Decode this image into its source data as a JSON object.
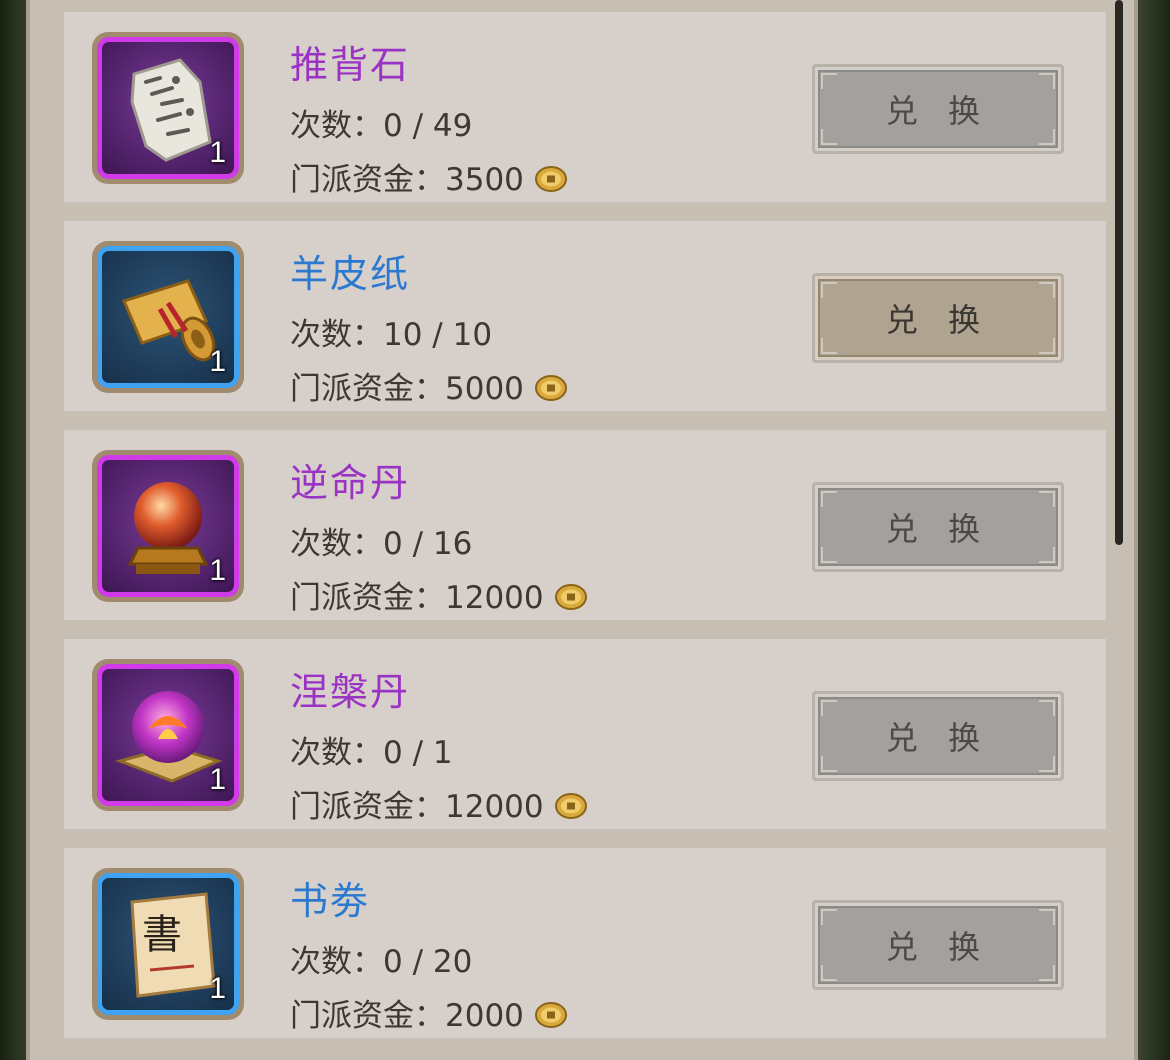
{
  "items": [
    {
      "name": "推背石",
      "rarity": "purple",
      "qty": "1",
      "count_label": "次数：",
      "count_value": "0 / 49",
      "fund_label": "门派资金：",
      "fund_value": "3500",
      "button_label": "兑 换",
      "button_state": "disabled",
      "icon": "stone-tablet-icon"
    },
    {
      "name": "羊皮纸",
      "rarity": "blue",
      "qty": "1",
      "count_label": "次数：",
      "count_value": "10 / 10",
      "fund_label": "门派资金：",
      "fund_value": "5000",
      "button_label": "兑 换",
      "button_state": "active",
      "icon": "scroll-icon"
    },
    {
      "name": "逆命丹",
      "rarity": "purple",
      "qty": "1",
      "count_label": "次数：",
      "count_value": "0 / 16",
      "fund_label": "门派资金：",
      "fund_value": "12000",
      "button_label": "兑 换",
      "button_state": "disabled",
      "icon": "orb-on-stand-icon"
    },
    {
      "name": "涅槃丹",
      "rarity": "purple",
      "qty": "1",
      "count_label": "次数：",
      "count_value": "0 / 1",
      "fund_label": "门派资金：",
      "fund_value": "12000",
      "button_label": "兑 换",
      "button_state": "disabled",
      "icon": "phoenix-orb-icon"
    },
    {
      "name": "书劵",
      "rarity": "blue",
      "qty": "1",
      "count_label": "次数：",
      "count_value": "0 / 20",
      "fund_label": "门派资金：",
      "fund_value": "2000",
      "button_label": "兑 换",
      "button_state": "disabled",
      "icon": "book-voucher-icon",
      "icon_text": "書"
    }
  ],
  "colors": {
    "purple_name": "#9a33c4",
    "blue_name": "#2a78d0",
    "purple_border": "#d13ae8",
    "blue_border": "#3fa3f2",
    "row_bg": "#d7d0ca"
  }
}
